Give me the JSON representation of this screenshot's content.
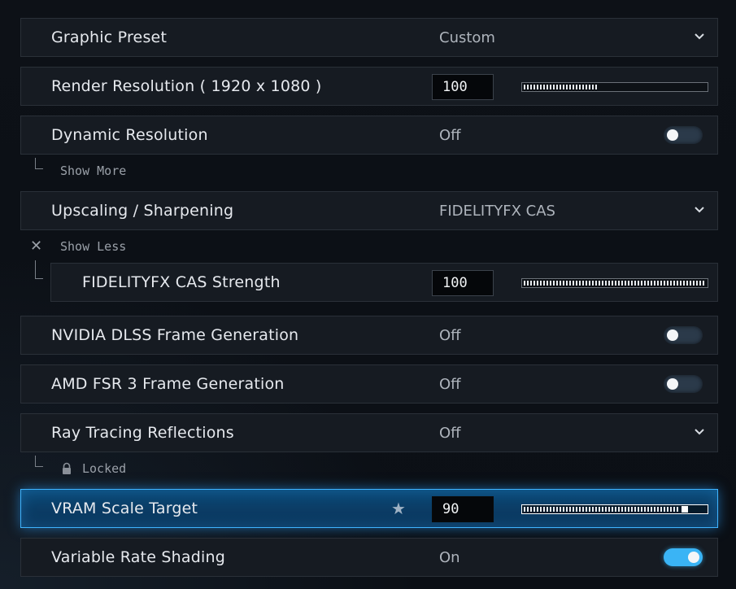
{
  "colors": {
    "accent": "#3ab4f5",
    "row_bg": "#161b22",
    "active_bg": "#0b3d66",
    "active_border": "#3fb4ff"
  },
  "settings": [
    {
      "label": "Graphic Preset",
      "value": "Custom",
      "control": "dropdown"
    },
    {
      "label": "Render Resolution ( 1920 x 1080 )",
      "number": "100",
      "control": "slider",
      "level": 0.4
    },
    {
      "label": "Dynamic Resolution",
      "value": "Off",
      "control": "toggle",
      "state": false
    },
    {
      "label": "Upscaling / Sharpening",
      "value": "FIDELITYFX CAS",
      "control": "dropdown"
    },
    {
      "label": "FIDELITYFX CAS Strength",
      "number": "100",
      "control": "slider",
      "level": 1.0
    },
    {
      "label": "NVIDIA DLSS Frame Generation",
      "value": "Off",
      "control": "toggle",
      "state": false
    },
    {
      "label": "AMD FSR 3 Frame Generation",
      "value": "Off",
      "control": "toggle",
      "state": false
    },
    {
      "label": "Ray Tracing Reflections",
      "value": "Off",
      "control": "dropdown"
    },
    {
      "label": "VRAM Scale Target",
      "number": "90",
      "control": "slider",
      "level": 0.9,
      "favorite_icon": "star-icon"
    },
    {
      "label": "Variable Rate Shading",
      "value": "On",
      "control": "toggle",
      "state": true
    }
  ],
  "sublinks": {
    "show_more": "Show More",
    "show_less": "Show Less",
    "locked": "Locked"
  },
  "icons": {
    "dropdown": "chevron-down-icon",
    "collapse": "close-icon",
    "lock": "lock-icon",
    "favorite": "star-icon"
  }
}
